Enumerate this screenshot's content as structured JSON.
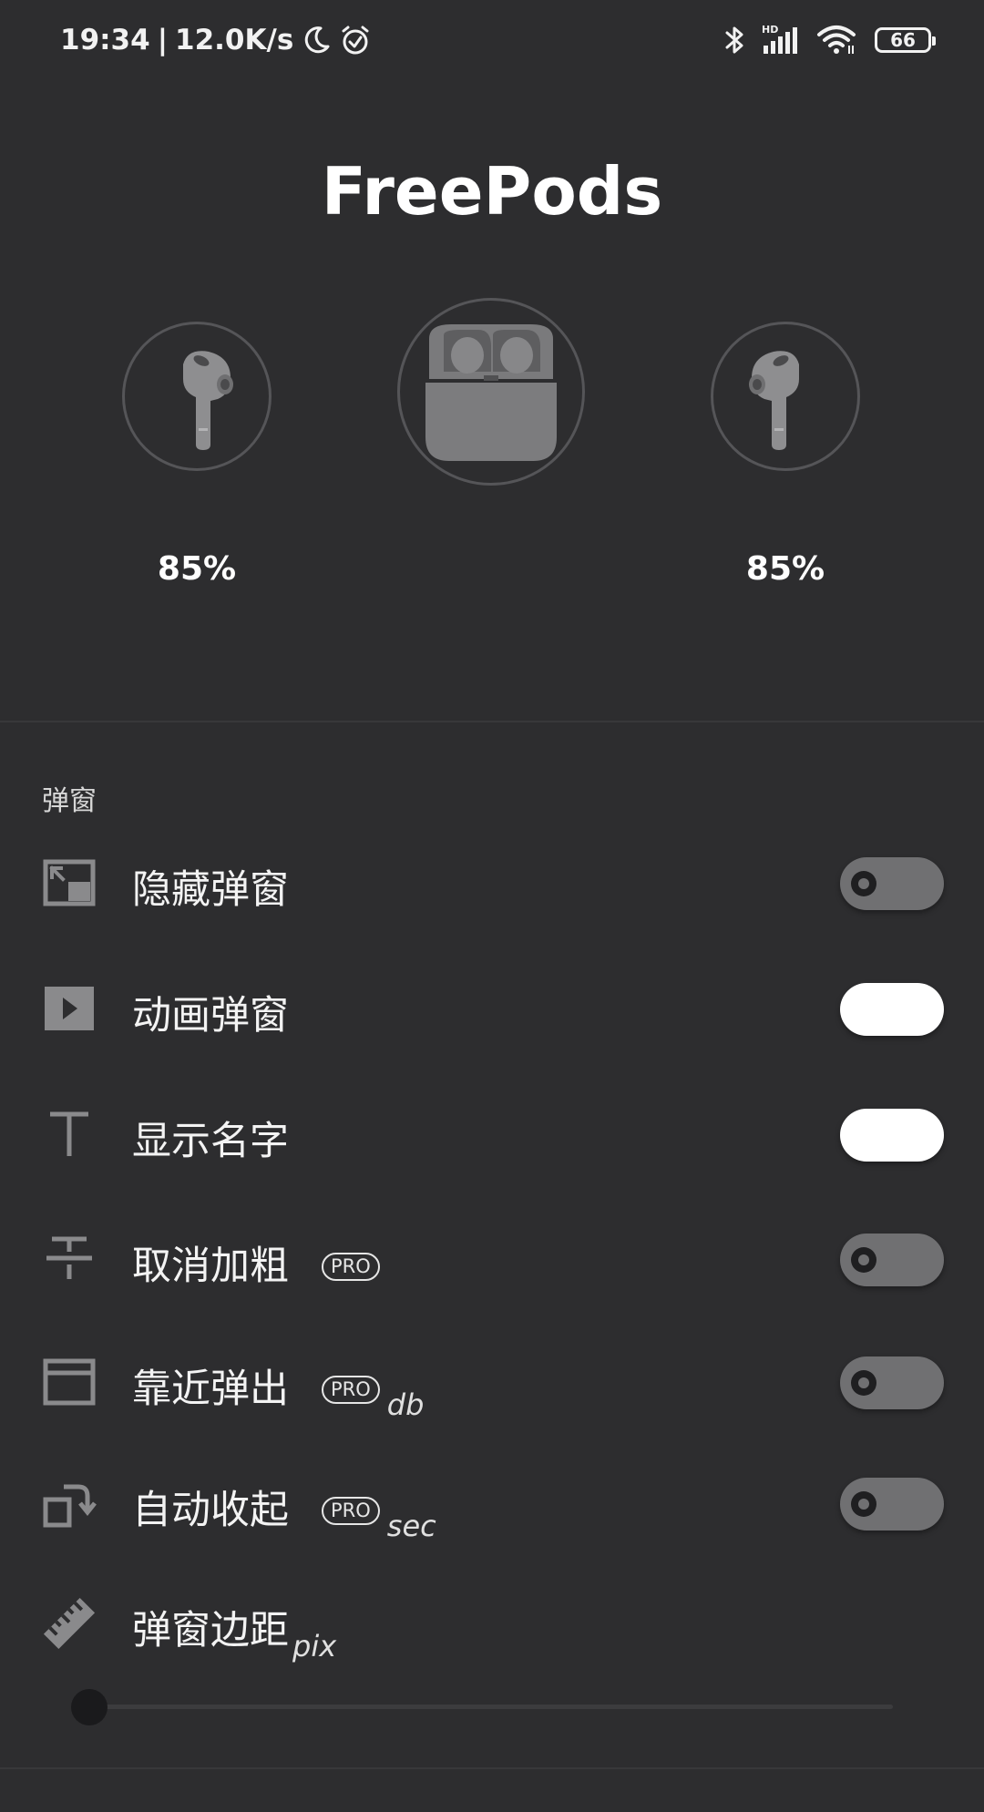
{
  "status_bar": {
    "time": "19:34",
    "separator": "|",
    "speed": "12.0K/s",
    "battery_level": "66"
  },
  "header": {
    "title": "FreePods"
  },
  "devices": {
    "left_battery": "85%",
    "right_battery": "85%"
  },
  "popup_section": {
    "label": "弹窗",
    "items": [
      {
        "label": "隐藏弹窗",
        "pro": false,
        "unit": "",
        "on": false
      },
      {
        "label": "动画弹窗",
        "pro": false,
        "unit": "",
        "on": true
      },
      {
        "label": "显示名字",
        "pro": false,
        "unit": "",
        "on": true
      },
      {
        "label": "取消加粗",
        "pro": true,
        "unit": "",
        "on": false
      },
      {
        "label": "靠近弹出",
        "pro": true,
        "unit": "db",
        "on": false
      },
      {
        "label": "自动收起",
        "pro": true,
        "unit": "sec",
        "on": false
      }
    ],
    "margin_setting": {
      "label": "弹窗边距",
      "unit": "pix",
      "value_fraction": 0.0
    },
    "pro_badge": "PRO"
  },
  "colors": {
    "background": "#2d2d2f",
    "toggle_off": "#707072",
    "toggle_on": "#ffffff",
    "icon": "#8a8a8c"
  },
  "icons": [
    "moon-icon",
    "alarm-icon",
    "bluetooth-icon",
    "signal-icon",
    "wifi-icon",
    "picture-in-picture-icon",
    "play-icon",
    "text-icon",
    "strikethrough-icon",
    "window-icon",
    "rotate-icon",
    "ruler-icon"
  ]
}
